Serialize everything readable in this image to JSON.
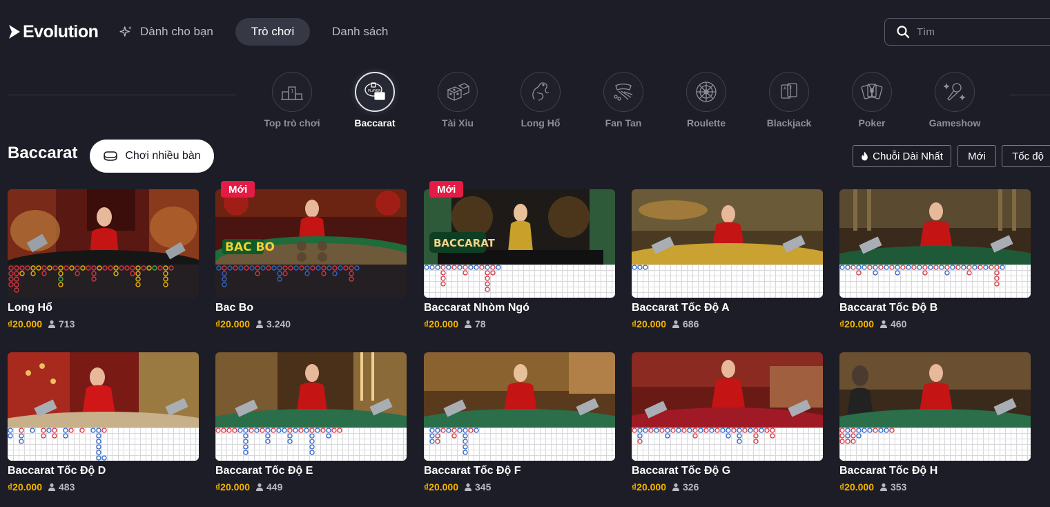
{
  "header": {
    "logo": "Evolution",
    "nav_for_you": "Dành cho bạn",
    "nav_games": "Trò chơi",
    "nav_list": "Danh sách",
    "search_placeholder": "Tìm"
  },
  "categories": [
    {
      "label": "Top trò chơi",
      "icon": "podium-icon"
    },
    {
      "label": "Baccarat",
      "icon": "baccarat-icon",
      "active": true
    },
    {
      "label": "Tài Xỉu",
      "icon": "dice-icon"
    },
    {
      "label": "Long Hổ",
      "icon": "dragon-icon"
    },
    {
      "label": "Fan Tan",
      "icon": "fan-tan-icon"
    },
    {
      "label": "Roulette",
      "icon": "roulette-icon"
    },
    {
      "label": "Blackjack",
      "icon": "cards-icon"
    },
    {
      "label": "Poker",
      "icon": "poker-icon"
    },
    {
      "label": "Gameshow",
      "icon": "microphone-icon"
    }
  ],
  "section": {
    "title": "Baccarat",
    "multi_table_label": "Chơi nhiều bàn",
    "filters": [
      "Chuỗi Dài Nhất",
      "Mới",
      "Tốc độ"
    ]
  },
  "games": [
    {
      "name": "Long Hổ",
      "bet": "₫20.000",
      "players": "713",
      "badge": ""
    },
    {
      "name": "Bac Bo",
      "bet": "₫20.000",
      "players": "3.240",
      "badge": "Mới"
    },
    {
      "name": "Baccarat Nhòm Ngó",
      "bet": "₫20.000",
      "players": "78",
      "badge": "Mới"
    },
    {
      "name": "Baccarat Tốc Độ A",
      "bet": "₫20.000",
      "players": "686",
      "badge": ""
    },
    {
      "name": "Baccarat Tốc Độ B",
      "bet": "₫20.000",
      "players": "460",
      "badge": ""
    },
    {
      "name": "Baccarat Tốc Độ D",
      "bet": "₫20.000",
      "players": "483",
      "badge": ""
    },
    {
      "name": "Baccarat Tốc Độ E",
      "bet": "₫20.000",
      "players": "449",
      "badge": ""
    },
    {
      "name": "Baccarat Tốc Độ F",
      "bet": "₫20.000",
      "players": "345",
      "badge": ""
    },
    {
      "name": "Baccarat Tốc Độ G",
      "bet": "₫20.000",
      "players": "326",
      "badge": ""
    },
    {
      "name": "Baccarat Tốc Độ H",
      "bet": "₫20.000",
      "players": "353",
      "badge": ""
    }
  ],
  "colors": {
    "background": "#1c1d26",
    "accent_gold": "#f5b400",
    "badge_red": "#e31b45",
    "road_banker": "#d9333f",
    "road_player": "#2f64c8"
  }
}
